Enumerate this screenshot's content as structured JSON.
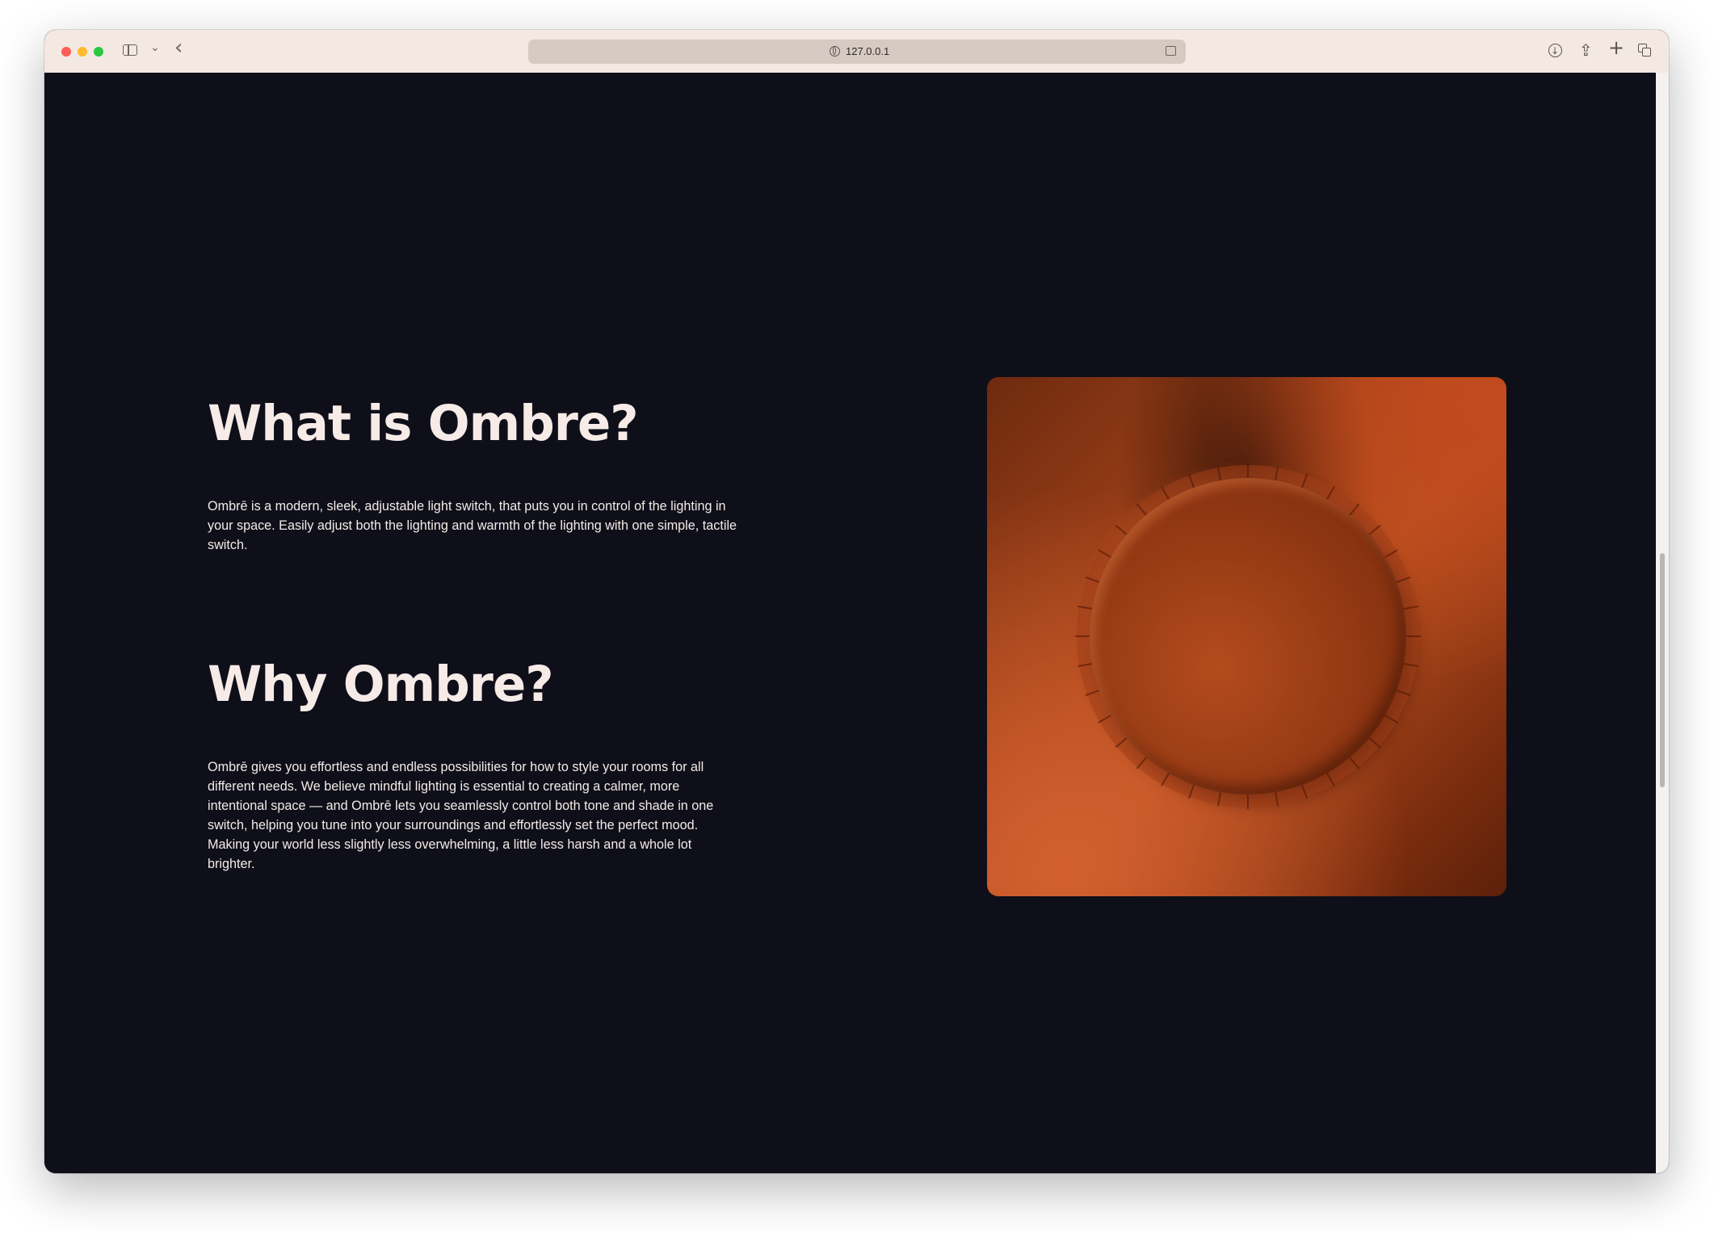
{
  "browser": {
    "url": "127.0.0.1"
  },
  "sections": {
    "what": {
      "heading": "What is Ombre?",
      "body": "Ombrē is a modern, sleek, adjustable light switch, that puts you in control of the lighting in your space. Easily adjust both the lighting and warmth of the lighting with one simple, tactile switch."
    },
    "why": {
      "heading": "Why Ombre?",
      "body": "Ombrē gives you effortless and endless possibilities for how to style your rooms for all different needs. We believe mindful lighting is essential to creating a calmer, more intentional space — and Ombrē lets you seamlessly control both tone and shade in one switch, helping you tune into your surroundings and effortlessly set the perfect mood. Making your world less slightly less overwhelming, a little less harsh and a whole lot brighter."
    }
  },
  "colors": {
    "background": "#0f0f1a",
    "text": "#f6ebe7",
    "product_orange": "#b9501f",
    "titlebar": "#f3e8e2"
  },
  "icons": {
    "traffic_lights": [
      "close-icon",
      "minimize-icon",
      "zoom-icon"
    ],
    "toolbar": [
      "sidebar-icon",
      "chevron-down-icon",
      "back-arrow-icon",
      "globe-icon",
      "reader-icon",
      "download-icon",
      "share-icon",
      "plus-icon",
      "tabs-icon"
    ]
  }
}
